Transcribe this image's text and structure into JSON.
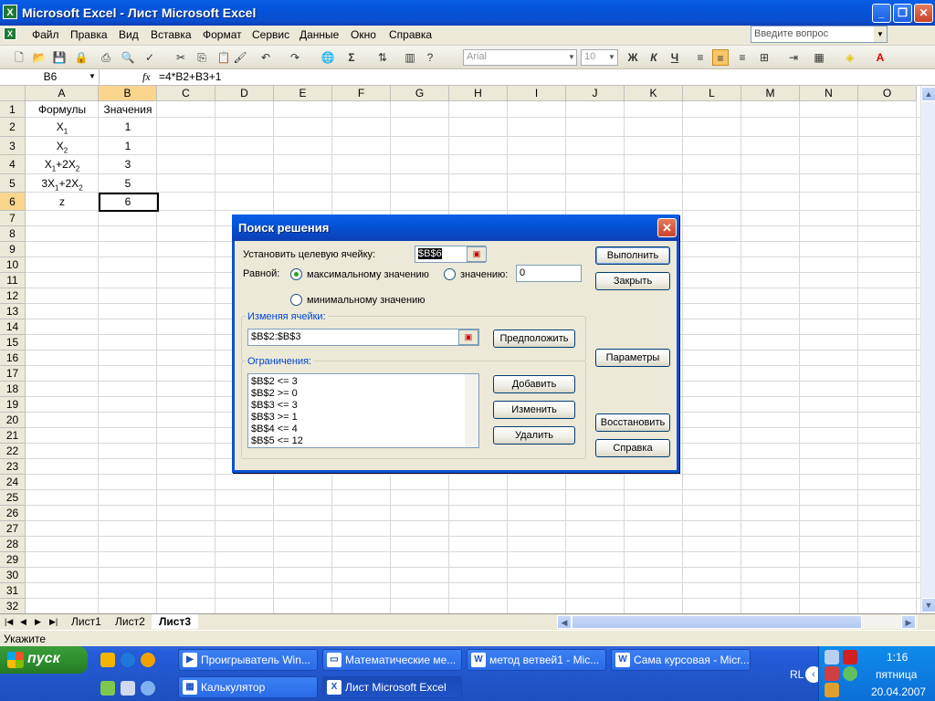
{
  "window": {
    "title": "Microsoft Excel - Лист Microsoft Excel"
  },
  "menu": {
    "items": [
      "Файл",
      "Правка",
      "Вид",
      "Вставка",
      "Формат",
      "Сервис",
      "Данные",
      "Окно",
      "Справка"
    ],
    "ask_placeholder": "Введите вопрос"
  },
  "toolbar": {
    "font": "Arial",
    "size": "10",
    "bold": "Ж",
    "italic": "К",
    "underline": "Ч",
    "sum": "Σ"
  },
  "formula_bar": {
    "name_box": "B6",
    "fx": "fx",
    "formula": "=4*B2+B3+1"
  },
  "grid": {
    "columns": [
      "A",
      "B",
      "C",
      "D",
      "E",
      "F",
      "G",
      "H",
      "I",
      "J",
      "K",
      "L",
      "M",
      "N",
      "O"
    ],
    "rows": [
      "1",
      "2",
      "3",
      "4",
      "5",
      "6",
      "7",
      "8",
      "9",
      "10",
      "11",
      "12",
      "13",
      "14",
      "15",
      "16",
      "17",
      "18",
      "19",
      "20",
      "21",
      "22",
      "23",
      "24",
      "25",
      "26",
      "27",
      "28",
      "29",
      "30",
      "31",
      "32"
    ],
    "cells": {
      "A1": "Формулы",
      "B1": "Значения",
      "B2": "1",
      "B3": "1",
      "B4": "3",
      "B5": "5",
      "A6": "z",
      "B6": "6"
    }
  },
  "sheets": {
    "tabs": [
      "Лист1",
      "Лист2",
      "Лист3"
    ],
    "active": "Лист3"
  },
  "status": {
    "text": "Укажите"
  },
  "dialog": {
    "title": "Поиск решения",
    "target_label": "Установить целевую ячейку:",
    "target_value": "$B$6",
    "equal_label": "Равной:",
    "opt_max": "максимальному значению",
    "opt_value": "значению:",
    "opt_value_input": "0",
    "opt_min": "минимальному значению",
    "changing_label": "Изменяя ячейки:",
    "changing_value": "$B$2:$B$3",
    "guess_button": "Предположить",
    "constraints_label": "Ограничения:",
    "constraints": [
      "$B$2 <= 3",
      "$B$2 >= 0",
      "$B$3 <= 3",
      "$B$3 >= 1",
      "$B$4 <= 4",
      "$B$5 <= 12"
    ],
    "add_button": "Добавить",
    "change_button": "Изменить",
    "delete_button": "Удалить",
    "run_button": "Выполнить",
    "close_button": "Закрыть",
    "params_button": "Параметры",
    "restore_button": "Восстановить",
    "help_button": "Справка"
  },
  "taskbar": {
    "start": "пуск",
    "tasks_row1": [
      "Проигрыватель Win...",
      "Математические ме...",
      "метод ветвей1 - Mic...",
      "Сама курсовая - Micr..."
    ],
    "tasks_row2": [
      "Калькулятор",
      "Лист Microsoft Excel"
    ],
    "lang": "RL",
    "clock": "1:16",
    "day": "пятница",
    "date": "20.04.2007"
  }
}
